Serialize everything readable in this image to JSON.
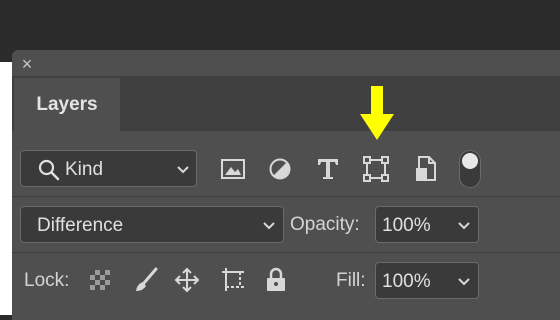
{
  "panel": {
    "close_glyph": "×",
    "tab_label": "Layers"
  },
  "filter": {
    "kind_label": "Kind",
    "icons": [
      "search-icon",
      "pixel-layer-filter-icon",
      "adjustment-layer-filter-icon",
      "type-layer-filter-icon",
      "shape-layer-filter-icon",
      "smart-object-filter-icon"
    ],
    "toggle_on": true
  },
  "blend": {
    "mode": "Difference",
    "opacity_label": "Opacity:",
    "opacity_value": "100%"
  },
  "lock": {
    "label": "Lock:",
    "icons": [
      "lock-transparent-pixels-icon",
      "lock-image-pixels-icon",
      "lock-position-icon",
      "lock-artboard-icon",
      "lock-all-icon"
    ],
    "fill_label": "Fill:",
    "fill_value": "100%"
  },
  "annotation": {
    "arrow_color": "#ffff00"
  },
  "colors": {
    "panel_bg": "#4f4f4f",
    "tabbar_bg": "#3f3f3f",
    "field_bg": "#3a3a3a"
  }
}
